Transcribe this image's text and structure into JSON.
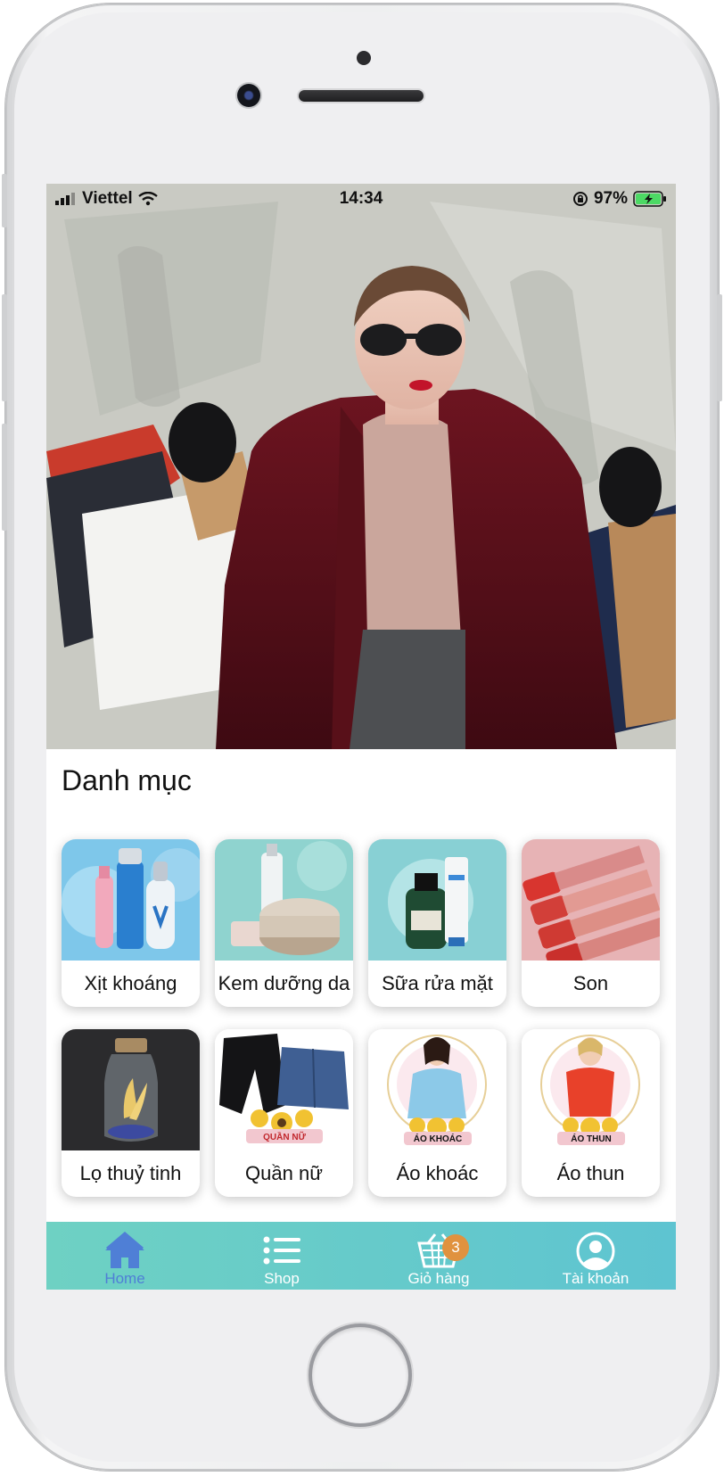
{
  "status_bar": {
    "carrier": "Viettel",
    "time": "14:34",
    "battery": "97%"
  },
  "section_title": "Danh mục",
  "categories": [
    {
      "label": "Xịt khoáng",
      "icon": "mineral-spray-products"
    },
    {
      "label": "Kem dưỡng da",
      "icon": "face-cream-products"
    },
    {
      "label": "Sữa rửa mặt",
      "icon": "facial-cleanser-products"
    },
    {
      "label": "Son",
      "icon": "lipstick-products"
    },
    {
      "label": "Lọ thuỷ tinh",
      "icon": "glass-jar"
    },
    {
      "label": "Quần nữ",
      "icon": "women-pants",
      "image_text": "QUẦN NỮ"
    },
    {
      "label": "Áo khoác",
      "icon": "jacket",
      "image_text": "ÁO KHOÁC"
    },
    {
      "label": "Áo thun",
      "icon": "t-shirt",
      "image_text": "ÁO THUN"
    }
  ],
  "tabbar": {
    "tabs": [
      {
        "label": "Home",
        "icon": "home-icon",
        "active": true
      },
      {
        "label": "Shop",
        "icon": "list-icon",
        "active": false
      },
      {
        "label": "Giỏ hàng",
        "icon": "cart-icon",
        "active": false,
        "badge": "3"
      },
      {
        "label": "Tài khoản",
        "icon": "account-icon",
        "active": false
      }
    ]
  },
  "colors": {
    "tabbar_start": "#6ed1c3",
    "tabbar_end": "#5ec4d1",
    "active_tab": "#4f7fd6",
    "badge": "#e0923f"
  }
}
